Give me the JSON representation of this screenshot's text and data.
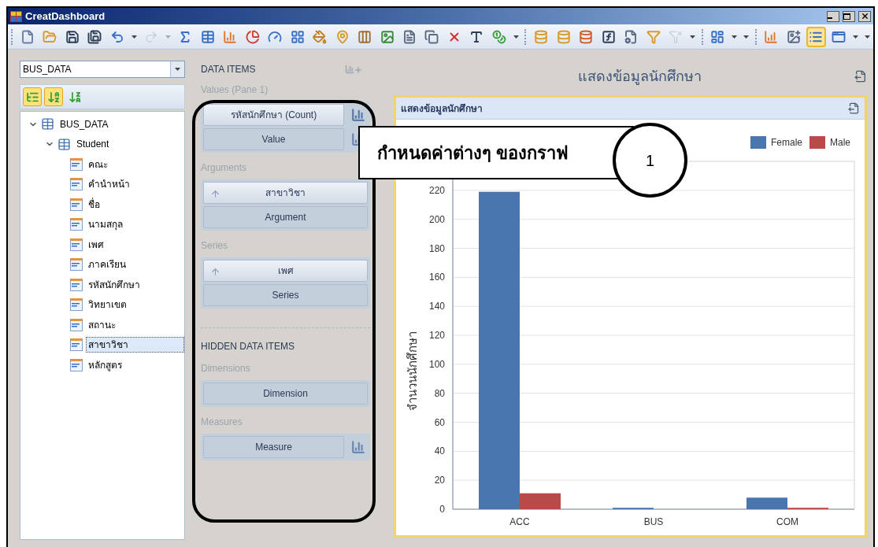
{
  "window": {
    "title": "CreatDashboard"
  },
  "toolbar": [
    {
      "kind": "grip"
    },
    {
      "kind": "button",
      "selected": false,
      "disabled": false
    },
    {
      "kind": "button",
      "selected": false,
      "disabled": false
    },
    {
      "kind": "button",
      "selected": false,
      "disabled": false
    },
    {
      "kind": "button",
      "selected": false,
      "disabled": false
    },
    {
      "kind": "button",
      "selected": false,
      "disabled": false
    },
    {
      "kind": "dropdown",
      "selected": false,
      "disabled": false
    },
    {
      "kind": "button",
      "selected": false,
      "disabled": true
    },
    {
      "kind": "dropdown",
      "selected": false,
      "disabled": true
    },
    {
      "kind": "button",
      "selected": false,
      "disabled": false
    },
    {
      "kind": "button",
      "selected": false,
      "disabled": false
    },
    {
      "kind": "button",
      "selected": false,
      "disabled": false
    },
    {
      "kind": "button",
      "selected": false,
      "disabled": false
    },
    {
      "kind": "button",
      "selected": false,
      "disabled": false
    },
    {
      "kind": "button",
      "selected": false,
      "disabled": false
    },
    {
      "kind": "button",
      "selected": false,
      "disabled": false
    },
    {
      "kind": "button",
      "selected": false,
      "disabled": false
    },
    {
      "kind": "button",
      "selected": false,
      "disabled": false
    },
    {
      "kind": "button",
      "selected": false,
      "disabled": false
    },
    {
      "kind": "button",
      "selected": false,
      "disabled": false
    },
    {
      "kind": "button",
      "selected": false,
      "disabled": false
    },
    {
      "kind": "button",
      "selected": false,
      "disabled": false
    },
    {
      "kind": "button",
      "selected": false,
      "disabled": false
    },
    {
      "kind": "button",
      "selected": false,
      "disabled": false
    },
    {
      "kind": "dropdown",
      "selected": false,
      "disabled": false
    },
    {
      "kind": "grip"
    },
    {
      "kind": "button",
      "selected": false,
      "disabled": false
    },
    {
      "kind": "button",
      "selected": false,
      "disabled": false
    },
    {
      "kind": "button",
      "selected": false,
      "disabled": false
    },
    {
      "kind": "button",
      "selected": false,
      "disabled": false
    },
    {
      "kind": "button",
      "selected": false,
      "disabled": false
    },
    {
      "kind": "button",
      "selected": false,
      "disabled": false
    },
    {
      "kind": "button",
      "selected": false,
      "disabled": true
    },
    {
      "kind": "dropdown",
      "selected": false,
      "disabled": false
    },
    {
      "kind": "grip"
    },
    {
      "kind": "button",
      "selected": false,
      "disabled": false
    },
    {
      "kind": "dropdown",
      "selected": false,
      "disabled": false
    },
    {
      "kind": "dropdown",
      "selected": false,
      "disabled": false
    },
    {
      "kind": "grip"
    },
    {
      "kind": "button",
      "selected": false,
      "disabled": false
    },
    {
      "kind": "button",
      "selected": false,
      "disabled": false
    },
    {
      "kind": "button",
      "selected": true,
      "disabled": false
    },
    {
      "kind": "button",
      "selected": false,
      "disabled": false
    },
    {
      "kind": "dropdown",
      "selected": false,
      "disabled": false
    },
    {
      "kind": "dropdown",
      "selected": false,
      "disabled": false
    }
  ],
  "data_source": {
    "value": "BUS_DATA"
  },
  "tree_toolbar": [
    {
      "selected": true
    },
    {
      "selected": true
    },
    {
      "selected": false
    }
  ],
  "tree": [
    {
      "label": "BUS_DATA",
      "kind": "source",
      "expanded": true,
      "selected": false,
      "children": [
        {
          "label": "Student",
          "kind": "table",
          "expanded": true,
          "selected": false,
          "children": [
            {
              "label": "คณะ",
              "kind": "field",
              "selected": false
            },
            {
              "label": "คำนำหน้า",
              "kind": "field",
              "selected": false
            },
            {
              "label": "ชื่อ",
              "kind": "field",
              "selected": false
            },
            {
              "label": "นามสกุล",
              "kind": "field",
              "selected": false
            },
            {
              "label": "เพศ",
              "kind": "field",
              "selected": false
            },
            {
              "label": "ภาคเรียน",
              "kind": "field",
              "selected": false
            },
            {
              "label": "รหัสนักศึกษา",
              "kind": "field",
              "selected": false
            },
            {
              "label": "วิทยาเขต",
              "kind": "field",
              "selected": false
            },
            {
              "label": "สถานะ",
              "kind": "field",
              "selected": false
            },
            {
              "label": "สาขาวิชา",
              "kind": "field",
              "selected": true
            },
            {
              "label": "หลักสูตร",
              "kind": "field",
              "selected": false
            }
          ]
        }
      ]
    }
  ],
  "data_items": {
    "title": "DATA ITEMS",
    "groups": [
      {
        "title": "Values (Pane 1)",
        "items": [
          {
            "label": "รหัสนักศึกษา (Count)",
            "kind": "measure",
            "filled": true
          },
          {
            "label": "Value",
            "kind": "measure",
            "filled": false
          }
        ]
      },
      {
        "title": "Arguments",
        "items": [
          {
            "label": "สาขาวิชา",
            "kind": "dimension",
            "filled": true
          },
          {
            "label": "Argument",
            "kind": "dimension",
            "filled": false
          }
        ]
      },
      {
        "title": "Series",
        "items": [
          {
            "label": "เพศ",
            "kind": "dimension",
            "filled": true
          },
          {
            "label": "Series",
            "kind": "dimension",
            "filled": false
          }
        ]
      }
    ]
  },
  "hidden_items": {
    "title": "HIDDEN DATA ITEMS",
    "groups": [
      {
        "title": "Dimensions",
        "items": [
          {
            "label": "Dimension",
            "kind": "dimension",
            "filled": false
          }
        ]
      },
      {
        "title": "Measures",
        "items": [
          {
            "label": "Measure",
            "kind": "measure",
            "filled": false
          }
        ]
      }
    ]
  },
  "dashboard": {
    "title": "แสดงข้อมูลนักศึกษา",
    "card_title": "แสดงข้อมูลนักศึกษา",
    "chart_data": {
      "type": "bar",
      "ylabel": "จำนวนนักศึกษา",
      "categories": [
        "ACC",
        "BUS",
        "COM"
      ],
      "series": [
        {
          "name": "Female",
          "color": "#4a76b0",
          "values": [
            219,
            1,
            8
          ]
        },
        {
          "name": "Male",
          "color": "#b84a4a",
          "values": [
            11,
            0,
            1
          ]
        }
      ],
      "grid": true,
      "legend": true,
      "ylim": [
        0,
        240
      ],
      "yticks": [
        0,
        20,
        40,
        60,
        80,
        100,
        120,
        140,
        160,
        180,
        200,
        220
      ]
    }
  },
  "annotation": {
    "callout": "กำหนดค่าต่างๆ ของกราฟ",
    "marker": "1"
  }
}
